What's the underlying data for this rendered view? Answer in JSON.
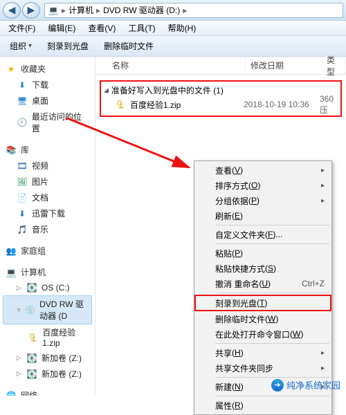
{
  "titlebar": {
    "crumb1": "计算机",
    "crumb2": "DVD RW 驱动器 (D:)"
  },
  "menubar": {
    "file": "文件(F)",
    "edit": "编辑(E)",
    "view": "查看(V)",
    "tools": "工具(T)",
    "help": "帮助(H)"
  },
  "toolbar": {
    "org": "组织",
    "burn": "刻录到光盘",
    "deltmp": "删除临时文件"
  },
  "nav": {
    "fav": "收藏夹",
    "dl": "下载",
    "desk": "桌面",
    "recent": "最近访问的位置",
    "lib": "库",
    "vid": "视频",
    "pic": "图片",
    "doc": "文档",
    "xl": "迅雷下载",
    "mus": "音乐",
    "hg": "家庭组",
    "comp": "计算机",
    "osc": "OS (C:)",
    "dvd": "DVD RW 驱动器 (D",
    "zip": "百度经验1.zip",
    "vol1": "新加卷 (Z:)",
    "vol2": "新加卷 (Z:)",
    "net": "网络"
  },
  "cols": {
    "name": "名称",
    "date": "修改日期",
    "type": "类型"
  },
  "list": {
    "groupHeader": "准备好写入到光盘中的文件 (1)",
    "file": {
      "name": "百度经验1.zip",
      "date": "2018-10-19 10:36",
      "type": "360压"
    }
  },
  "ctx": {
    "view": "查看",
    "sort": "排序方式",
    "group": "分组依据",
    "refresh": "刷新",
    "custom": "自定义文件夹",
    "paste": "粘贴",
    "pasteShortcut": "粘贴快捷方式",
    "undo": "撤消 重命名",
    "undoSc": "Ctrl+Z",
    "burn": "刻录到光盘",
    "deltmp": "删除临时文件",
    "opencmd": "在此处打开命令窗口",
    "share": "共享",
    "sync": "共享文件夹同步",
    "new": "新建",
    "props": "属性",
    "k": {
      "v": "V",
      "o": "O",
      "p": "P",
      "e": "E",
      "f": "F",
      "s": "S",
      "u": "U",
      "t": "T",
      "w": "W",
      "h": "H",
      "n": "N",
      "r": "R"
    }
  },
  "wm": "纯净系统家园"
}
